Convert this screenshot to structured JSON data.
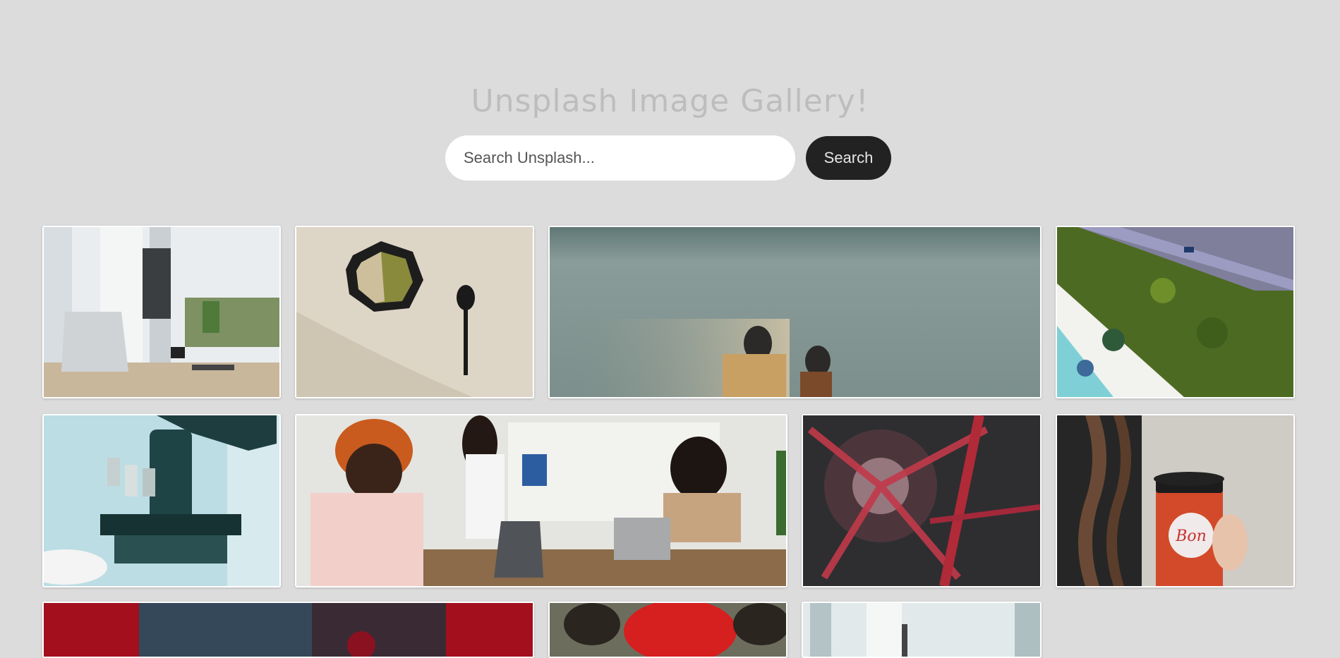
{
  "header": {
    "title": "Unsplash Image Gallery!"
  },
  "search": {
    "placeholder": "Search Unsplash...",
    "button_label": "Search"
  },
  "gallery": {
    "images": [
      {
        "subject": "desk-workspace"
      },
      {
        "subject": "bowl-and-spoon"
      },
      {
        "subject": "motion-blur-people"
      },
      {
        "subject": "aerial-beach-road"
      },
      {
        "subject": "microscope"
      },
      {
        "subject": "office-meeting"
      },
      {
        "subject": "red-abstract-blur"
      },
      {
        "subject": "coffee-cup-braids"
      },
      {
        "subject": "red-teal-portrait"
      },
      {
        "subject": "red-flower"
      },
      {
        "subject": "window-room"
      }
    ],
    "cup_text": "Bon"
  }
}
